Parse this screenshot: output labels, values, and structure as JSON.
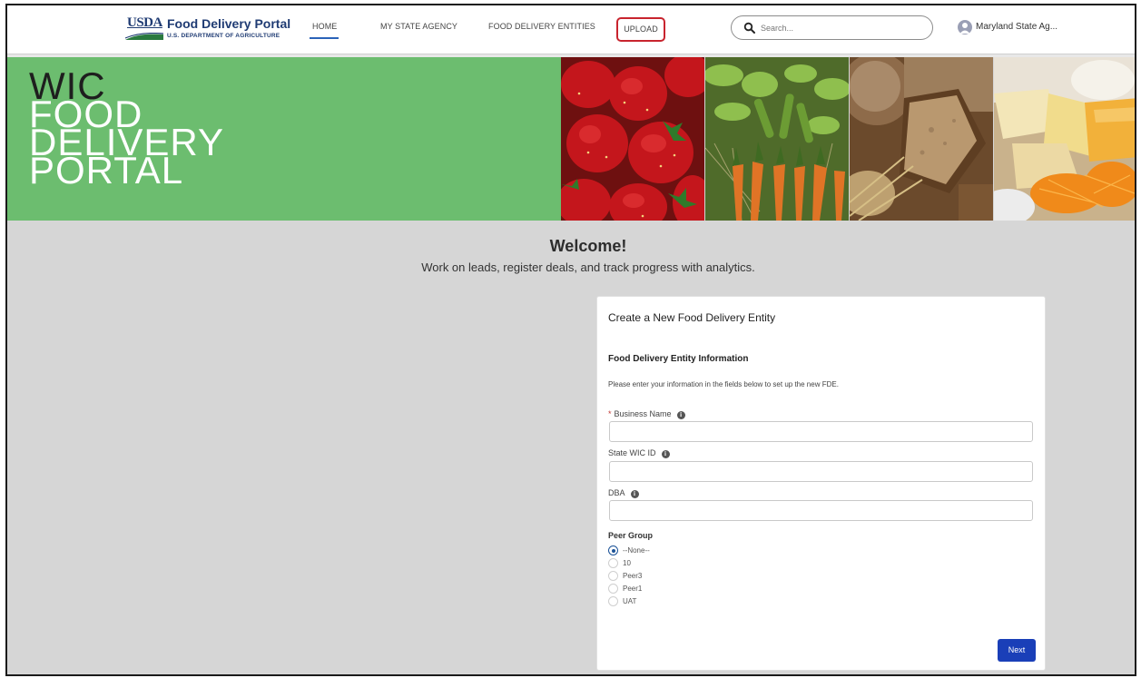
{
  "header": {
    "logo": {
      "mark": "USDA",
      "title": "Food Delivery Portal",
      "subtitle": "U.S. DEPARTMENT OF AGRICULTURE"
    },
    "nav": [
      {
        "label": "HOME",
        "active": true
      },
      {
        "label": "MY STATE AGENCY",
        "active": false
      },
      {
        "label": "FOOD DELIVERY ENTITIES",
        "active": false
      },
      {
        "label": "UPLOAD",
        "active": false,
        "highlighted": true
      }
    ],
    "search": {
      "placeholder": "Search...",
      "value": "",
      "icon": "search-icon"
    },
    "user": {
      "name": "Maryland State Ag...",
      "icon": "avatar-icon"
    }
  },
  "hero": {
    "title_lines": [
      "WIC",
      "FOOD",
      "DELIVERY",
      "PORTAL"
    ],
    "images": [
      "strawberries",
      "vegetables",
      "bread",
      "cheese"
    ],
    "background_color": "#6cbd6f"
  },
  "welcome": {
    "title": "Welcome!",
    "subtitle": "Work on leads, register deals, and track progress with analytics."
  },
  "form": {
    "title": "Create a New Food Delivery Entity",
    "section_title": "Food Delivery Entity Information",
    "helper_text": "Please enter your information in the fields below to set up the new FDE.",
    "fields": [
      {
        "label": "Business Name",
        "required": true,
        "required_mark": "*",
        "value": "",
        "info_icon": "i"
      },
      {
        "label": "State WIC ID",
        "required": false,
        "value": "",
        "info_icon": "i"
      },
      {
        "label": "DBA",
        "required": false,
        "value": "",
        "info_icon": "i"
      }
    ],
    "peer_group": {
      "label": "Peer Group",
      "options": [
        "--None--",
        "10",
        "Peer3",
        "Peer1",
        "UAT"
      ],
      "selected": "--None--"
    },
    "next_label": "Next"
  },
  "colors": {
    "brand_navy": "#1f3b73",
    "upload_highlight": "#c8242e",
    "primary_button": "#1a3fb8",
    "page_background": "#d6d6d6"
  }
}
